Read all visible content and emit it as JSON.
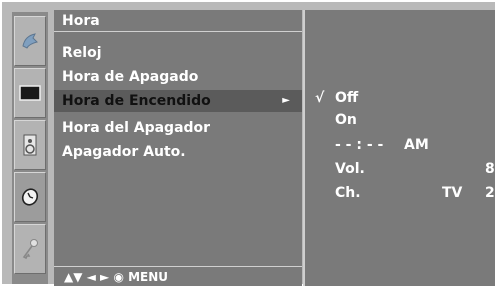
{
  "menu": {
    "title": "Hora",
    "items": [
      {
        "label": "Reloj"
      },
      {
        "label": "Hora de Apagado"
      },
      {
        "label": "Hora de Encendido",
        "arrow": "►"
      },
      {
        "label": "Hora del Apagador"
      },
      {
        "label": "Apagador Auto."
      }
    ],
    "help": "▲▼  ◄ ►  ◉  MENU"
  },
  "submenu": {
    "check": "√",
    "off": "Off",
    "on": "On",
    "time": "- -  :  - -",
    "ampm": "AM",
    "vol_label": "Vol.",
    "vol_value": "8",
    "ch_label": "Ch.",
    "ch_type": "TV",
    "ch_value": "2"
  },
  "icons": [
    "satellite-dish-icon",
    "screen-icon",
    "speaker-icon",
    "clock-icon",
    "key-icon"
  ]
}
